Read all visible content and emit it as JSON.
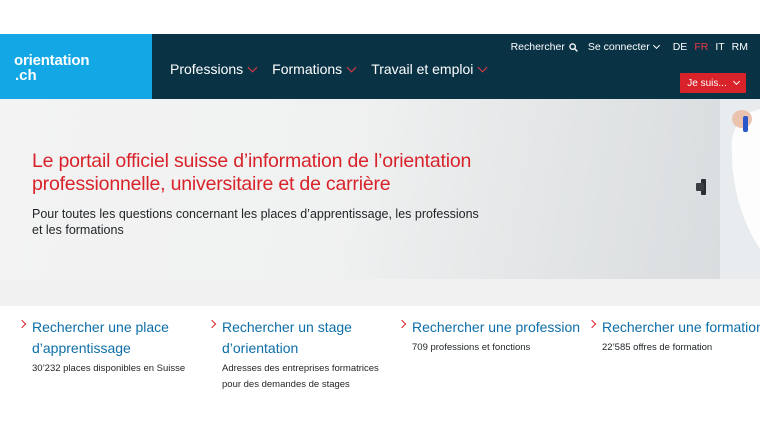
{
  "logo": {
    "line1": "orientation",
    "line2": ".ch"
  },
  "main_nav": [
    {
      "label": "Professions"
    },
    {
      "label": "Formations"
    },
    {
      "label": "Travail et emploi"
    }
  ],
  "top_nav": {
    "search_label": "Rechercher",
    "login_label": "Se connecter",
    "languages": [
      "DE",
      "FR",
      "IT",
      "RM"
    ],
    "active_language": "FR"
  },
  "je_suis": {
    "label": "Je suis..."
  },
  "hero": {
    "title": "Le portail officiel suisse d’information de l’orientation professionnelle, universitaire et de carrière",
    "subtitle": "Pour toutes les questions concernant les places d’apprentissage, les professions et les formations"
  },
  "quick_links": [
    {
      "title": "Rechercher une place d’apprentissage",
      "subtitle": "30’232 places disponibles en Suisse"
    },
    {
      "title": "Rechercher un stage d’orientation",
      "subtitle": "Adresses des entreprises formatrices pour des demandes de stages"
    },
    {
      "title": "Rechercher une profession",
      "subtitle": "709 professions et fonctions"
    },
    {
      "title": "Rechercher une formation",
      "subtitle": "22’585 offres de formation"
    }
  ],
  "colors": {
    "header": "#093245",
    "logo_bg": "#13a7e6",
    "accent_red": "#d8232a",
    "link_blue": "#0d6ea8"
  }
}
